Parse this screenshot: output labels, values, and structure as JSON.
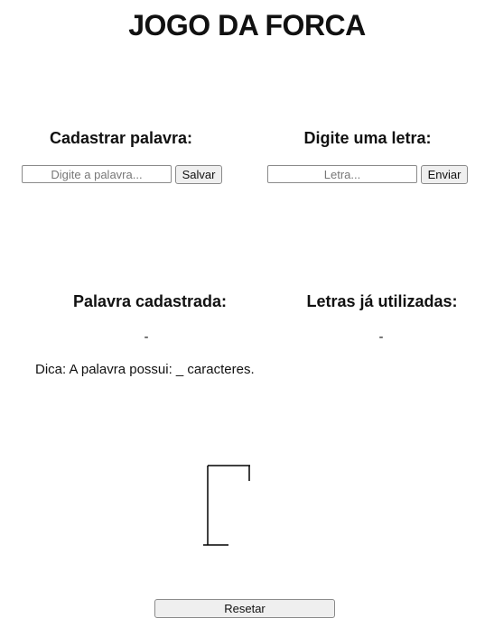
{
  "app": {
    "title": "JOGO DA FORCA"
  },
  "register": {
    "heading": "Cadastrar palavra:",
    "input_placeholder": "Digite a palavra...",
    "input_value": "",
    "save_label": "Salvar"
  },
  "guess": {
    "heading": "Digite uma letra:",
    "input_placeholder": "Letra...",
    "input_value": "",
    "send_label": "Enviar"
  },
  "status": {
    "word_heading": "Palavra cadastrada:",
    "word_value": "-",
    "letters_heading": "Letras já utilizadas:",
    "letters_value": "-"
  },
  "hint": {
    "text": "Dica: A palavra possui: _ caracteres."
  },
  "controls": {
    "reset_label": "Resetar"
  }
}
